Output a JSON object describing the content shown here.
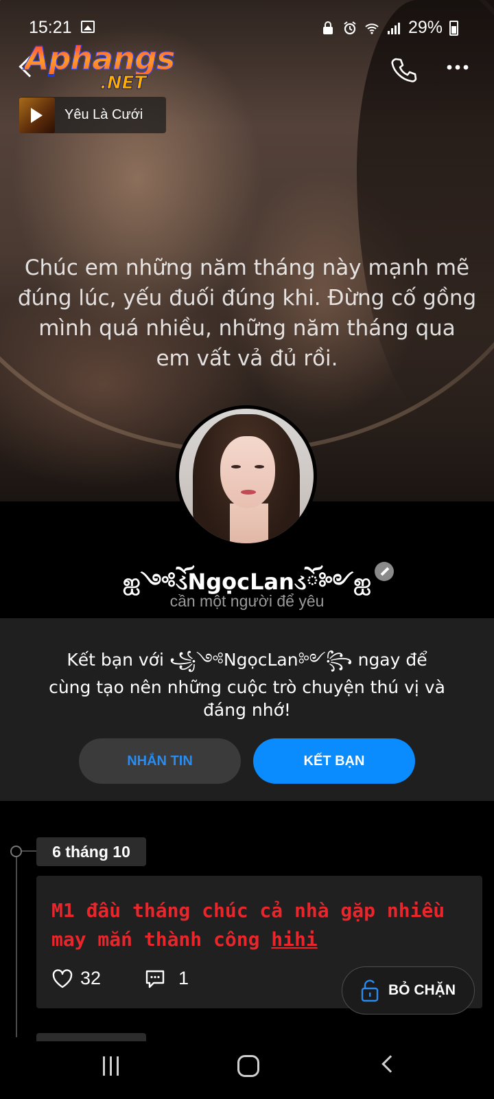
{
  "status_bar": {
    "time": "15:21",
    "battery": "29%",
    "icons": [
      "photo-icon",
      "lock-icon",
      "alarm-icon",
      "wifi-icon",
      "signal-icon",
      "battery-icon"
    ]
  },
  "logo": {
    "main": "Aphangs",
    "suffix": ".NET"
  },
  "header": {
    "icons": [
      "back-arrow-icon",
      "phone-icon",
      "more-icon"
    ]
  },
  "music": {
    "title": "Yêu Là Cưới"
  },
  "cover_quote": {
    "lines": [
      "Chúc em những năm tháng này mạnh mẽ",
      "đúng lúc, yếu đuối đúng khi. Đừng cố gồng",
      "mình quá nhiều, những năm tháng qua",
      "em vất vả đủ rồi."
    ]
  },
  "profile": {
    "name": "ஐ︎༺ོડNgọcLanડོ༻ஐ︎",
    "bio": "cần một người để yêu"
  },
  "friend_panel": {
    "line1": "Kết bạn với ꧁༺NgọcLan༻꧂ ngay để",
    "line2": "cùng tạo nên những cuộc trò chuyện thú vị và đáng nhớ!",
    "message_label": "NHẮN TIN",
    "add_friend_label": "KẾT BẠN"
  },
  "timeline": {
    "date": "6 tháng 10",
    "post": {
      "text": "M1 đầu tháng chúc cả nhà gặp nhiều may mắn thành công ",
      "link_text": "hihi",
      "likes": "32",
      "comments": "1"
    }
  },
  "unblock": {
    "label": "BỎ CHẶN"
  },
  "colors": {
    "accent_blue": "#0a8cff",
    "post_red": "#e8262c",
    "panel_bg": "#1f1f1f"
  }
}
